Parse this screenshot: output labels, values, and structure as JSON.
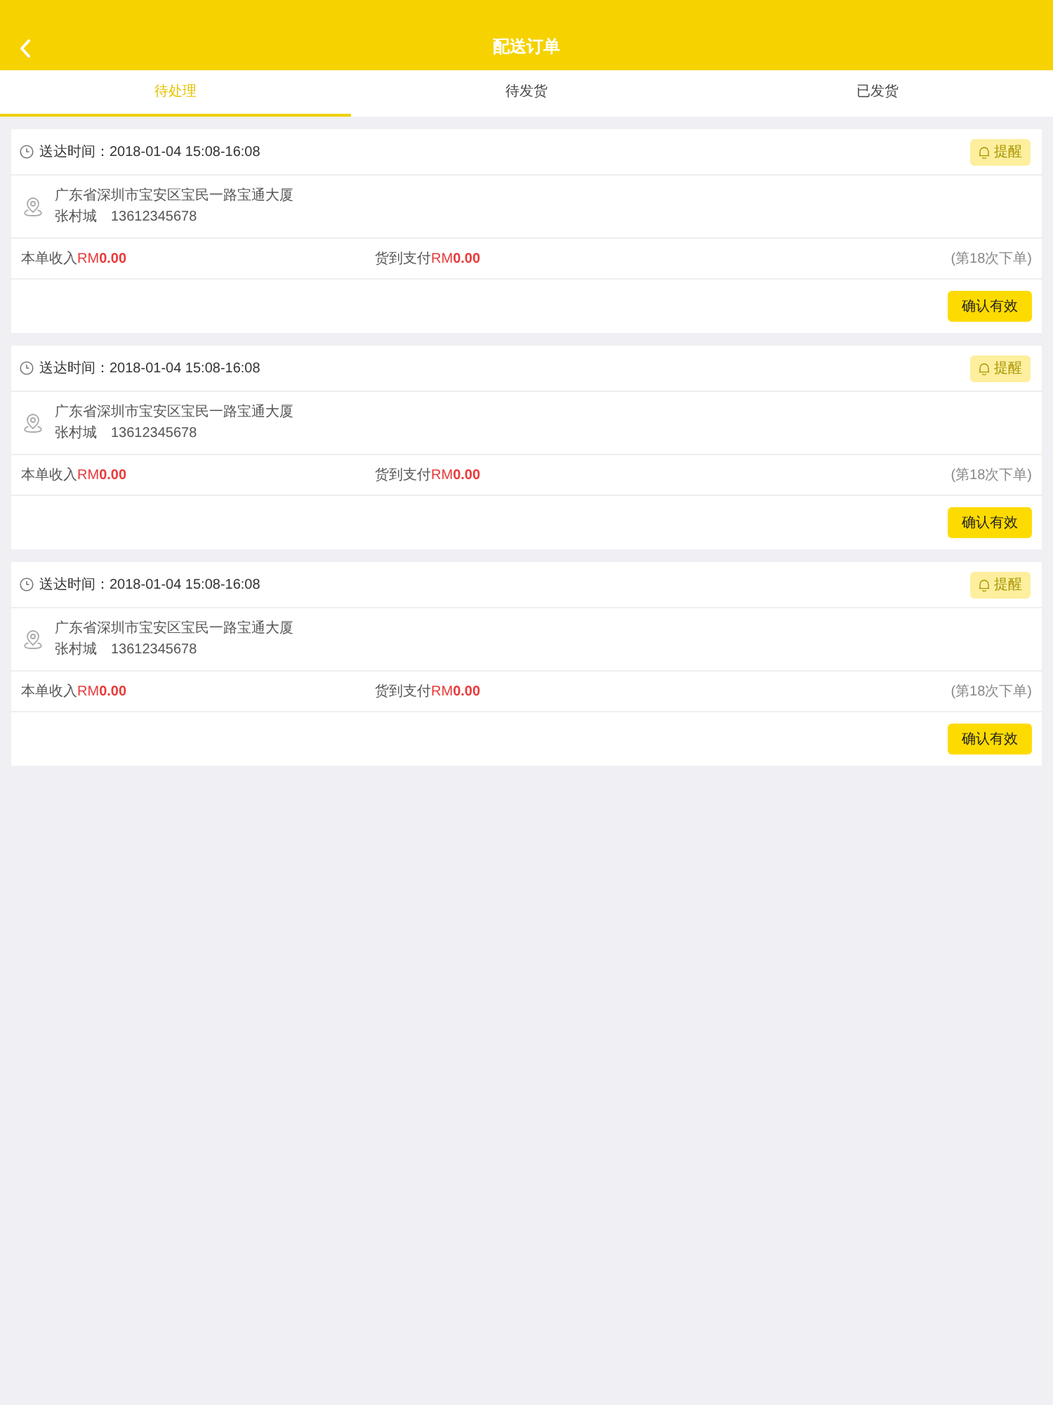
{
  "header": {
    "title": "配送订单"
  },
  "tabs": [
    {
      "label": "待处理",
      "selected": true
    },
    {
      "label": "待发货",
      "selected": false
    },
    {
      "label": "已发货",
      "selected": false
    }
  ],
  "orders": [
    {
      "delivery_time": "送达时间：2018-01-04 15:08-16:08",
      "remind_button": "提醒",
      "address": "广东省深圳市宝安区宝民一路宝通大厦",
      "contact_name": "张村城",
      "phone": "13612345678",
      "income": {
        "label": "本单收入",
        "amount": "RM**0.00**"
      },
      "cod": {
        "label": "货到支付",
        "amount": "RM**0.00**"
      },
      "order_count": "(第18次下单)",
      "confirm_button": "确认有效"
    },
    {
      "delivery_time": "送达时间：2018-01-04 15:08-16:08",
      "remind_button": "提醒",
      "address": "广东省深圳市宝安区宝民一路宝通大厦",
      "contact_name": "张村城",
      "phone": "13612345678",
      "income": {
        "label": "本单收入",
        "amount": "RM**0.00**"
      },
      "cod": {
        "label": "货到支付",
        "amount": "RM**0.00**"
      },
      "order_count": "(第18次下单)",
      "confirm_button": "确认有效"
    },
    {
      "delivery_time": "送达时间：2018-01-04 15:08-16:08",
      "remind_button": "提醒",
      "address": "广东省深圳市宝安区宝民一路宝通大厦",
      "contact_name": "张村城",
      "phone": "13612345678",
      "income": {
        "label": "本单收入",
        "amount": "RM**0.00**"
      },
      "cod": {
        "label": "货到支付",
        "amount": "RM**0.00**"
      },
      "order_count": "(第18次下单)",
      "confirm_button": "确认有效"
    }
  ]
}
